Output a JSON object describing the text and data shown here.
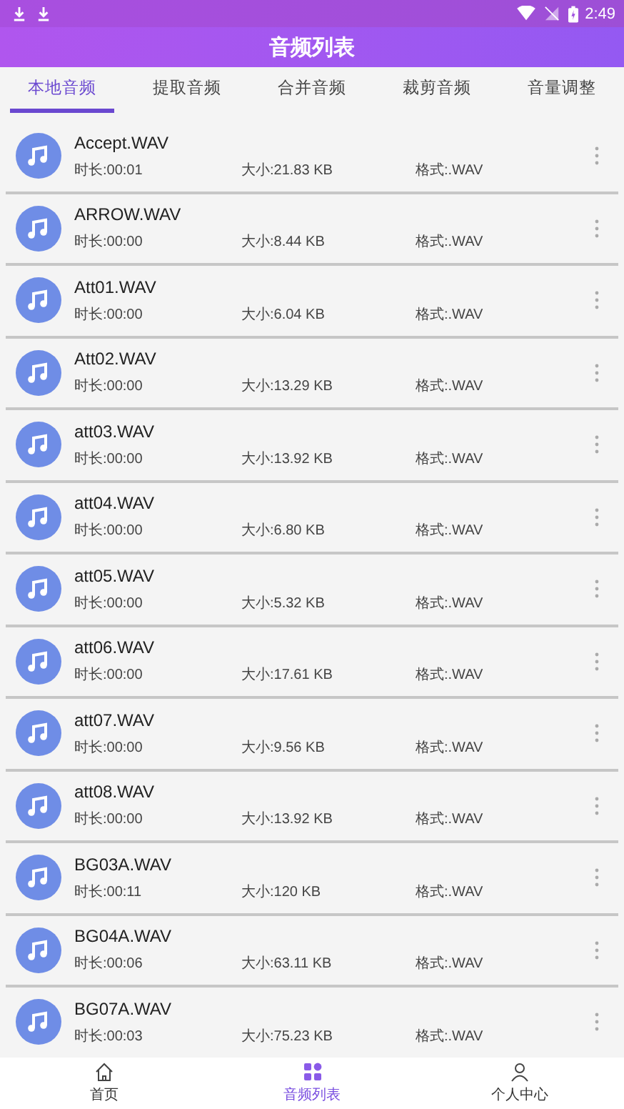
{
  "status_bar": {
    "time": "2:49"
  },
  "title": "音频列表",
  "tabs": [
    {
      "label": "本地音频",
      "selected": true
    },
    {
      "label": "提取音频",
      "selected": false
    },
    {
      "label": "合并音频",
      "selected": false
    },
    {
      "label": "裁剪音频",
      "selected": false
    },
    {
      "label": "音量调整",
      "selected": false
    }
  ],
  "files": [
    {
      "name": "Accept.WAV",
      "duration": "时长:00:01",
      "size": "大小:21.83 KB",
      "format": "格式:.WAV"
    },
    {
      "name": "ARROW.WAV",
      "duration": "时长:00:00",
      "size": "大小:8.44 KB",
      "format": "格式:.WAV"
    },
    {
      "name": "Att01.WAV",
      "duration": "时长:00:00",
      "size": "大小:6.04 KB",
      "format": "格式:.WAV"
    },
    {
      "name": "Att02.WAV",
      "duration": "时长:00:00",
      "size": "大小:13.29 KB",
      "format": "格式:.WAV"
    },
    {
      "name": "att03.WAV",
      "duration": "时长:00:00",
      "size": "大小:13.92 KB",
      "format": "格式:.WAV"
    },
    {
      "name": "att04.WAV",
      "duration": "时长:00:00",
      "size": "大小:6.80 KB",
      "format": "格式:.WAV"
    },
    {
      "name": "att05.WAV",
      "duration": "时长:00:00",
      "size": "大小:5.32 KB",
      "format": "格式:.WAV"
    },
    {
      "name": "att06.WAV",
      "duration": "时长:00:00",
      "size": "大小:17.61 KB",
      "format": "格式:.WAV"
    },
    {
      "name": "att07.WAV",
      "duration": "时长:00:00",
      "size": "大小:9.56 KB",
      "format": "格式:.WAV"
    },
    {
      "name": "att08.WAV",
      "duration": "时长:00:00",
      "size": "大小:13.92 KB",
      "format": "格式:.WAV"
    },
    {
      "name": "BG03A.WAV",
      "duration": "时长:00:11",
      "size": "大小:120 KB",
      "format": "格式:.WAV"
    },
    {
      "name": "BG04A.WAV",
      "duration": "时长:00:06",
      "size": "大小:63.11 KB",
      "format": "格式:.WAV"
    },
    {
      "name": "BG07A.WAV",
      "duration": "时长:00:03",
      "size": "大小:75.23 KB",
      "format": "格式:.WAV"
    }
  ],
  "bottom_nav": [
    {
      "kind": "home",
      "label": "首页",
      "selected": false
    },
    {
      "kind": "list",
      "label": "音频列表",
      "selected": true
    },
    {
      "kind": "person",
      "label": "个人中心",
      "selected": false
    }
  ]
}
